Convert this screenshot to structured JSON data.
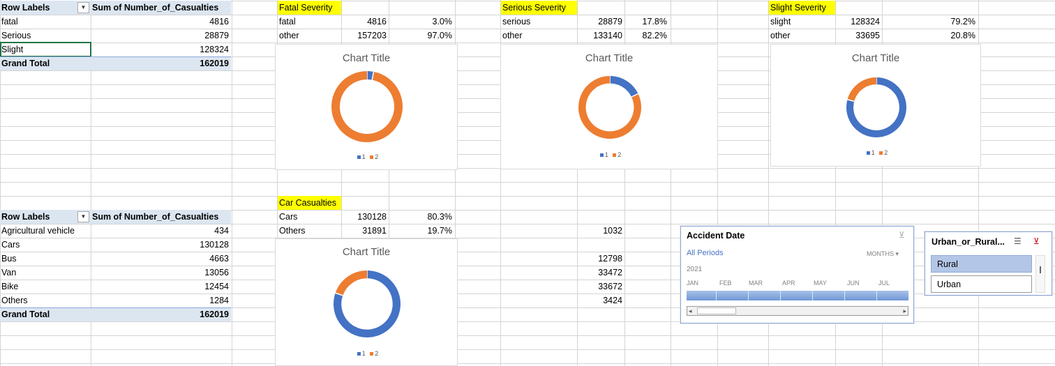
{
  "pivot_severity": {
    "header_label": "Row Labels",
    "header_value": "Sum of Number_of_Casualties",
    "rows": [
      {
        "label": "fatal",
        "value": "4816"
      },
      {
        "label": "Serious",
        "value": "28879"
      },
      {
        "label": "Slight",
        "value": "128324"
      }
    ],
    "total_label": "Grand Total",
    "total_value": "162019"
  },
  "pivot_vehicle": {
    "header_label": "Row Labels",
    "header_value": "Sum of Number_of_Casualties",
    "rows": [
      {
        "label": "Agricultural vehicle",
        "value": "434"
      },
      {
        "label": "Cars",
        "value": "130128"
      },
      {
        "label": "Bus",
        "value": "4663"
      },
      {
        "label": "Van",
        "value": "13056"
      },
      {
        "label": "Bike",
        "value": "12454"
      },
      {
        "label": "Others",
        "value": "1284"
      }
    ],
    "total_label": "Grand Total",
    "total_value": "162019"
  },
  "blocks": [
    {
      "title": "Fatal Severity",
      "rows": [
        [
          "fatal",
          "4816",
          "3.0%"
        ],
        [
          "other",
          "157203",
          "97.0%"
        ]
      ]
    },
    {
      "title": "Serious Severity",
      "rows": [
        [
          "serious",
          "28879",
          "17.8%"
        ],
        [
          "other",
          "133140",
          "82.2%"
        ]
      ]
    },
    {
      "title": "Slight Severity",
      "rows": [
        [
          "slight",
          "128324",
          "79.2%"
        ],
        [
          "other",
          "33695",
          "20.8%"
        ]
      ]
    },
    {
      "title": "Car Casualties",
      "rows": [
        [
          "Cars",
          "130128",
          "80.3%"
        ],
        [
          "Others",
          "31891",
          "19.7%"
        ]
      ]
    }
  ],
  "misc_values": [
    "1032",
    "12798",
    "33472",
    "33672",
    "3424"
  ],
  "chart_data": [
    {
      "type": "pie",
      "title": "Chart Title",
      "values": [
        4816,
        157203
      ],
      "legend": [
        "1",
        "2"
      ],
      "colors": [
        "#4472c4",
        "#ed7d31"
      ],
      "hole": "donut"
    },
    {
      "type": "pie",
      "title": "Chart Title",
      "values": [
        28879,
        133140
      ],
      "legend": [
        "1",
        "2"
      ],
      "colors": [
        "#4472c4",
        "#ed7d31"
      ],
      "hole": "donut"
    },
    {
      "type": "pie",
      "title": "Chart Title",
      "values": [
        128324,
        33695
      ],
      "legend": [
        "1",
        "2"
      ],
      "colors": [
        "#4472c4",
        "#ed7d31"
      ],
      "hole": "donut"
    },
    {
      "type": "pie",
      "title": "Chart Title",
      "values": [
        130128,
        31891
      ],
      "legend": [
        "1",
        "2"
      ],
      "colors": [
        "#4472c4",
        "#ed7d31"
      ],
      "hole": "donut"
    }
  ],
  "timeline": {
    "title": "Accident Date",
    "periods": "All Periods",
    "level": "MONTHS",
    "year": "2021",
    "months": [
      "JAN",
      "FEB",
      "MAR",
      "APR",
      "MAY",
      "JUN",
      "JUL"
    ]
  },
  "slicer": {
    "title": "Urban_or_Rural...",
    "items": [
      {
        "label": "Rural",
        "selected": true
      },
      {
        "label": "Urban",
        "selected": false
      }
    ]
  },
  "colors": {
    "accent_blue": "#4472c4",
    "accent_orange": "#ed7d31",
    "highlight": "#ffff00",
    "pivot_band": "#dce6f1"
  }
}
